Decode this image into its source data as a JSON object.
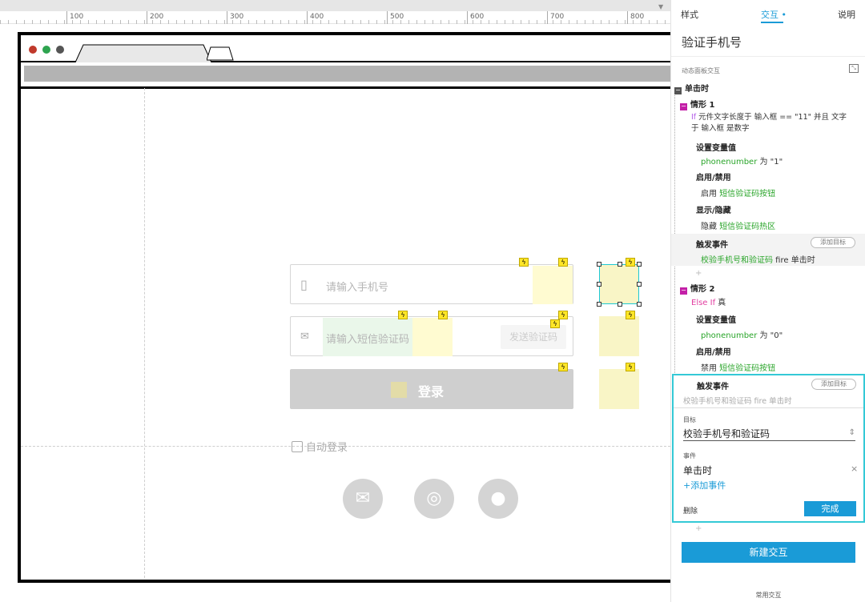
{
  "ruler": {
    "marks": [
      "100",
      "200",
      "300",
      "400",
      "500",
      "600",
      "700",
      "800"
    ]
  },
  "canvas": {
    "phone_placeholder": "请输入手机号",
    "code_placeholder": "请输入短信验证码",
    "send_code_label": "发送验证码",
    "login_label": "登录",
    "auto_login_label": "自动登录",
    "social": [
      "wechat-icon",
      "weibo-icon",
      "qq-icon"
    ]
  },
  "panel": {
    "tabs": {
      "style": "样式",
      "interaction": "交互",
      "notes": "说明"
    },
    "title": "验证手机号",
    "section_label": "动态面板交互",
    "event": "单击时",
    "case1": {
      "name": "情形 1",
      "condition_if": "If",
      "condition_line1": " 元件文字长度于 输入框 == \"11\" 并且 文字",
      "condition_line2": "于 输入框 是数字",
      "actions": [
        {
          "title": "设置变量值",
          "detail_var": "phonenumber",
          "detail_rest": " 为 \"1\""
        },
        {
          "title": "启用/禁用",
          "detail_prefix": "启用 ",
          "detail_target": "短信验证码按钮"
        },
        {
          "title": "显示/隐藏",
          "detail_prefix": "隐藏 ",
          "detail_target": "短信验证码热区"
        },
        {
          "title": "触发事件",
          "detail_target": "校验手机号和验证码",
          "detail_rest": " fire 单击时",
          "add_target": "添加目标"
        }
      ]
    },
    "case2": {
      "name": "情形 2",
      "condition_else": "Else If",
      "condition_rest": " 真",
      "actions": [
        {
          "title": "设置变量值",
          "detail_var": "phonenumber",
          "detail_rest": " 为 \"0\""
        },
        {
          "title": "启用/禁用",
          "detail_prefix": "禁用 ",
          "detail_target": "短信验证码按钮"
        },
        {
          "title": "触发事件",
          "add_target": "添加目标",
          "summary": "校验手机号和验证码 fire 单击时"
        }
      ]
    },
    "editor": {
      "target_label": "目标",
      "target_value": "校验手机号和验证码",
      "event_label": "事件",
      "event_value": "单击时",
      "add_event": "+添加事件",
      "delete": "删除",
      "done": "完成"
    },
    "new_interaction": "新建交互",
    "common_label": "常用交互"
  }
}
